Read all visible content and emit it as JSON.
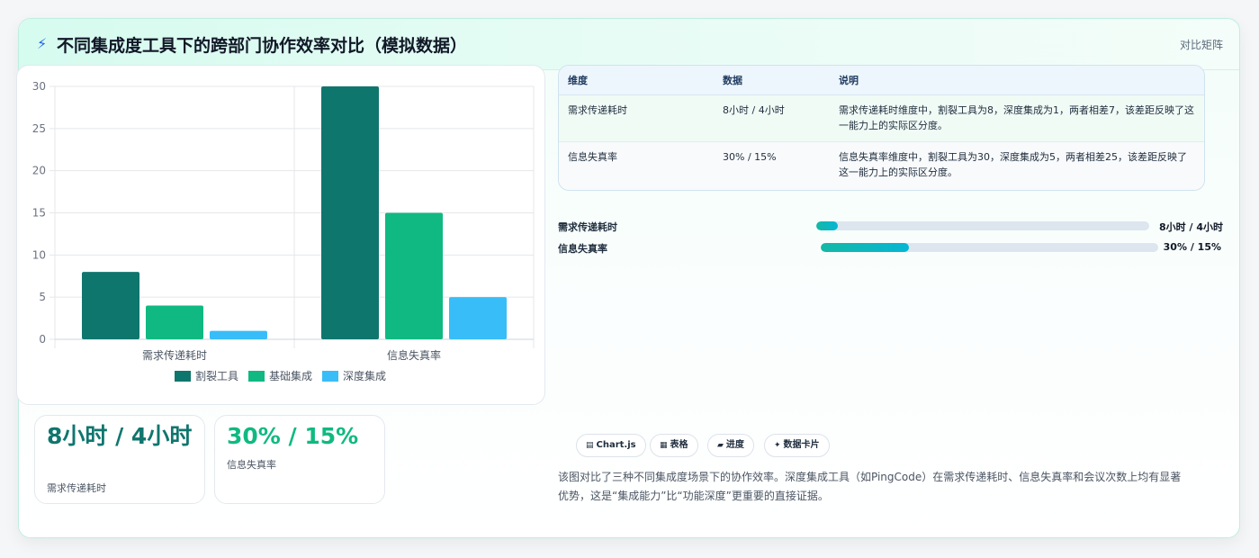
{
  "header": {
    "icon": "lightning-icon",
    "title": "不同集成度工具下的跨部门协作效率对比（模拟数据）",
    "tag": "对比矩阵"
  },
  "colors": {
    "split": "#0f766e",
    "basic": "#10b981",
    "deep": "#38bdf8",
    "accent": "#14b8a6"
  },
  "chart_data": {
    "type": "bar",
    "title": "",
    "xlabel": "",
    "ylabel": "",
    "categories": [
      "需求传递耗时",
      "信息失真率"
    ],
    "series": [
      {
        "name": "割裂工具",
        "values": [
          8,
          30
        ],
        "color": "#0f766e"
      },
      {
        "name": "基础集成",
        "values": [
          4,
          15
        ],
        "color": "#10b981"
      },
      {
        "name": "深度集成",
        "values": [
          1,
          5
        ],
        "color": "#38bdf8"
      }
    ],
    "ylim": [
      0,
      30
    ],
    "yticks": [
      0,
      5,
      10,
      15,
      20,
      25,
      30
    ],
    "grid": true,
    "legend": "bottom"
  },
  "kpis": [
    {
      "value": "8小时 / 4小时",
      "label": "需求传递耗时",
      "color": "#0f766e"
    },
    {
      "value": "30% / 15%",
      "label": "信息失真率",
      "color": "#10b981"
    }
  ],
  "table": {
    "headers": [
      "维度",
      "数据",
      "说明"
    ],
    "rows": [
      {
        "dim": "需求传递耗时",
        "data": "8小时 / 4小时",
        "note": "需求传递耗时维度中，割裂工具为8，深度集成为1，两者相差7，该差距反映了这一能力上的实际区分度。"
      },
      {
        "dim": "信息失真率",
        "data": "30% / 15%",
        "note": "信息失真率维度中，割裂工具为30，深度集成为5，两者相差25，该差距反映了这一能力上的实际区分度。"
      }
    ]
  },
  "progress": [
    {
      "label": "需求传递耗时",
      "value_text": "8小时 / 4小时",
      "fraction": 0.066
    },
    {
      "label": "信息失真率",
      "value_text": "30% / 15%",
      "fraction": 0.26
    }
  ],
  "chips": [
    {
      "icon": "chart-icon",
      "glyph": "▤",
      "label": "Chart.js"
    },
    {
      "icon": "table-icon",
      "glyph": "▦",
      "label": "表格"
    },
    {
      "icon": "progress-icon",
      "glyph": "▰",
      "label": "进度"
    },
    {
      "icon": "sparkle-icon",
      "glyph": "✦",
      "label": "数据卡片"
    }
  ],
  "footer": "该图对比了三种不同集成度场景下的协作效率。深度集成工具（如PingCode）在需求传递耗时、信息失真率和会议次数上均有显著优势，这是“集成能力”比“功能深度”更重要的直接证据。"
}
